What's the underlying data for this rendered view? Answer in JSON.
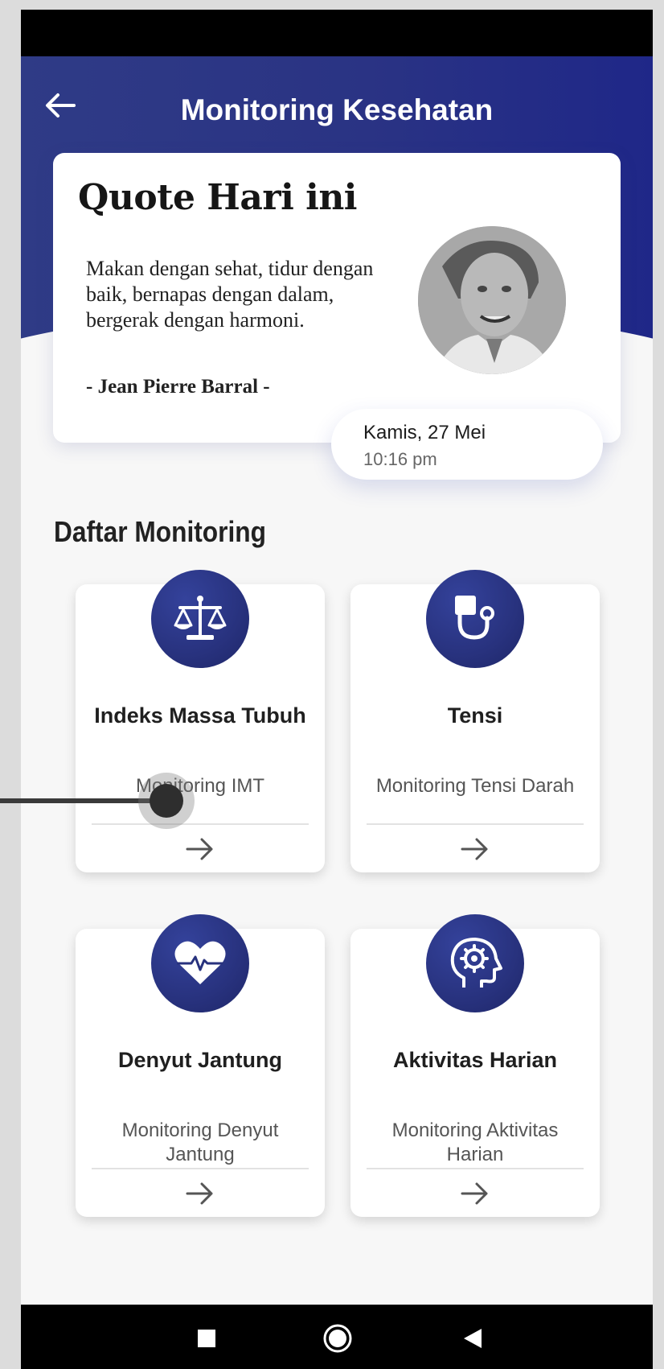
{
  "header": {
    "title": "Monitoring Kesehatan",
    "back_icon": "arrow-left-icon"
  },
  "quote": {
    "heading": "Quote Hari ini",
    "text": "Makan dengan sehat, tidur dengan baik, bernapas dengan dalam, bergerak dengan harmoni.",
    "author": "- Jean Pierre Barral -",
    "date": "Kamis, 27 Mei",
    "time": "10:16 pm"
  },
  "section": {
    "title": "Daftar Monitoring"
  },
  "cards": [
    {
      "title": "Indeks Massa Tubuh",
      "subtitle": "Monitoring IMT",
      "icon": "balance-scale-icon"
    },
    {
      "title": "Tensi",
      "subtitle": "Monitoring Tensi Darah",
      "icon": "blood-pressure-icon"
    },
    {
      "title": "Denyut Jantung",
      "subtitle": "Monitoring Denyut Jantung",
      "icon": "heart-pulse-icon"
    },
    {
      "title": "Aktivitas Harian",
      "subtitle": "Monitoring Aktivitas Harian",
      "icon": "head-gear-icon"
    }
  ],
  "colors": {
    "header_primary": "#2a3384",
    "icon_circle": "#28327e",
    "background": "#f7f7f7"
  },
  "nav": {
    "icons": [
      "square-recents-icon",
      "circle-home-icon",
      "triangle-back-icon"
    ]
  }
}
